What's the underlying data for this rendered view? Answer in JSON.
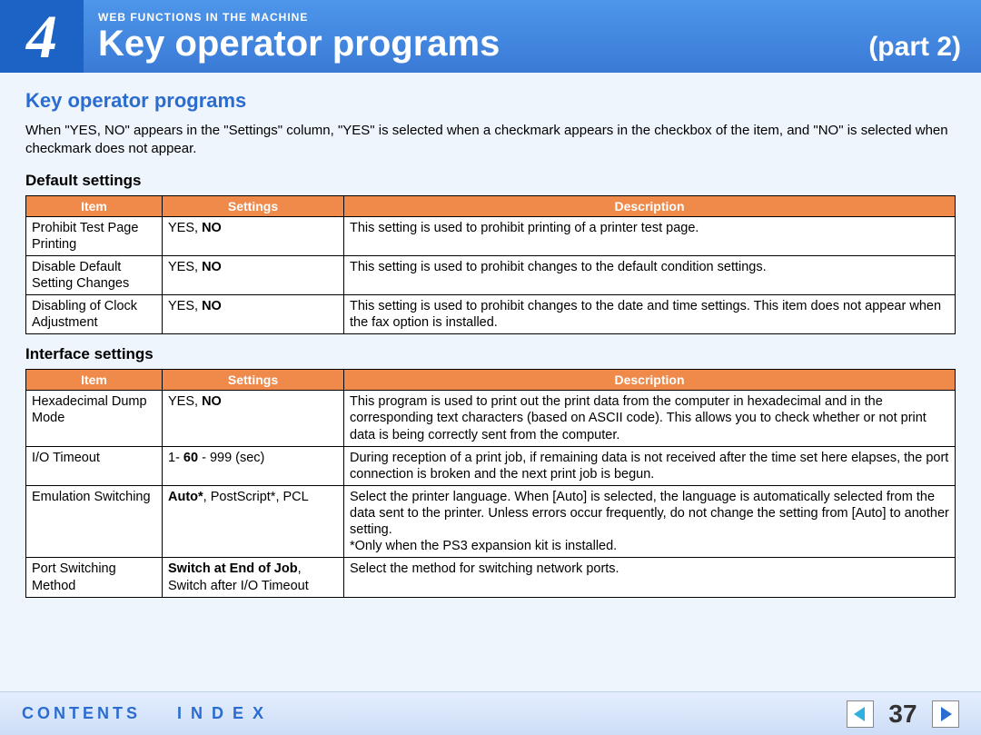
{
  "banner": {
    "chapter_number": "4",
    "kicker": "WEB FUNCTIONS IN THE MACHINE",
    "title": "Key operator programs",
    "part": "(part 2)"
  },
  "section": {
    "heading": "Key operator programs",
    "intro": "When \"YES, NO\" appears in the \"Settings\" column, \"YES\" is selected when a checkmark appears in the checkbox of the item, and \"NO\" is selected when checkmark does not appear."
  },
  "table_headers": {
    "item": "Item",
    "settings": "Settings",
    "description": "Description"
  },
  "default_settings": {
    "title": "Default settings",
    "rows": [
      {
        "item": "Prohibit Test Page Printing",
        "settings_html": "YES, <b>NO</b>",
        "description": "This setting is used to prohibit printing of a printer test page."
      },
      {
        "item": "Disable Default Setting Changes",
        "settings_html": "YES, <b>NO</b>",
        "description": "This setting is used to prohibit changes to the default condition settings."
      },
      {
        "item": "Disabling of Clock Adjustment",
        "settings_html": "YES, <b>NO</b>",
        "description": "This setting is used to prohibit changes to the date and time settings. This item does not appear when the fax option is installed."
      }
    ]
  },
  "interface_settings": {
    "title": "Interface settings",
    "rows": [
      {
        "item": "Hexadecimal Dump Mode",
        "settings_html": "YES, <b>NO</b>",
        "description": "This program is used to print out the print data from the computer in hexadecimal and in the corresponding text characters (based on ASCII code). This allows you to check whether or not print data is being correctly sent from the computer."
      },
      {
        "item": "I/O Timeout",
        "settings_html": "1- <b>60</b> - 999 (sec)",
        "description": "During reception of a print job, if remaining data is not received after the time set here elapses, the port connection is broken and the next print job is begun."
      },
      {
        "item": "Emulation Switching",
        "settings_html": "<b>Auto*</b>, PostScript*, PCL",
        "description": "Select the printer language. When [Auto] is selected, the language is automatically selected from the data sent to the printer. Unless errors occur frequently, do not change the setting from [Auto] to another setting.<br>*Only when the PS3 expansion kit is installed."
      },
      {
        "item": "Port Switching Method",
        "settings_html": "<b>Switch at End of Job</b>, Switch after I/O Timeout",
        "description": "Select the method for switching network ports."
      }
    ]
  },
  "footer": {
    "contents": "CONTENTS",
    "index": "INDEX",
    "page": "37"
  }
}
